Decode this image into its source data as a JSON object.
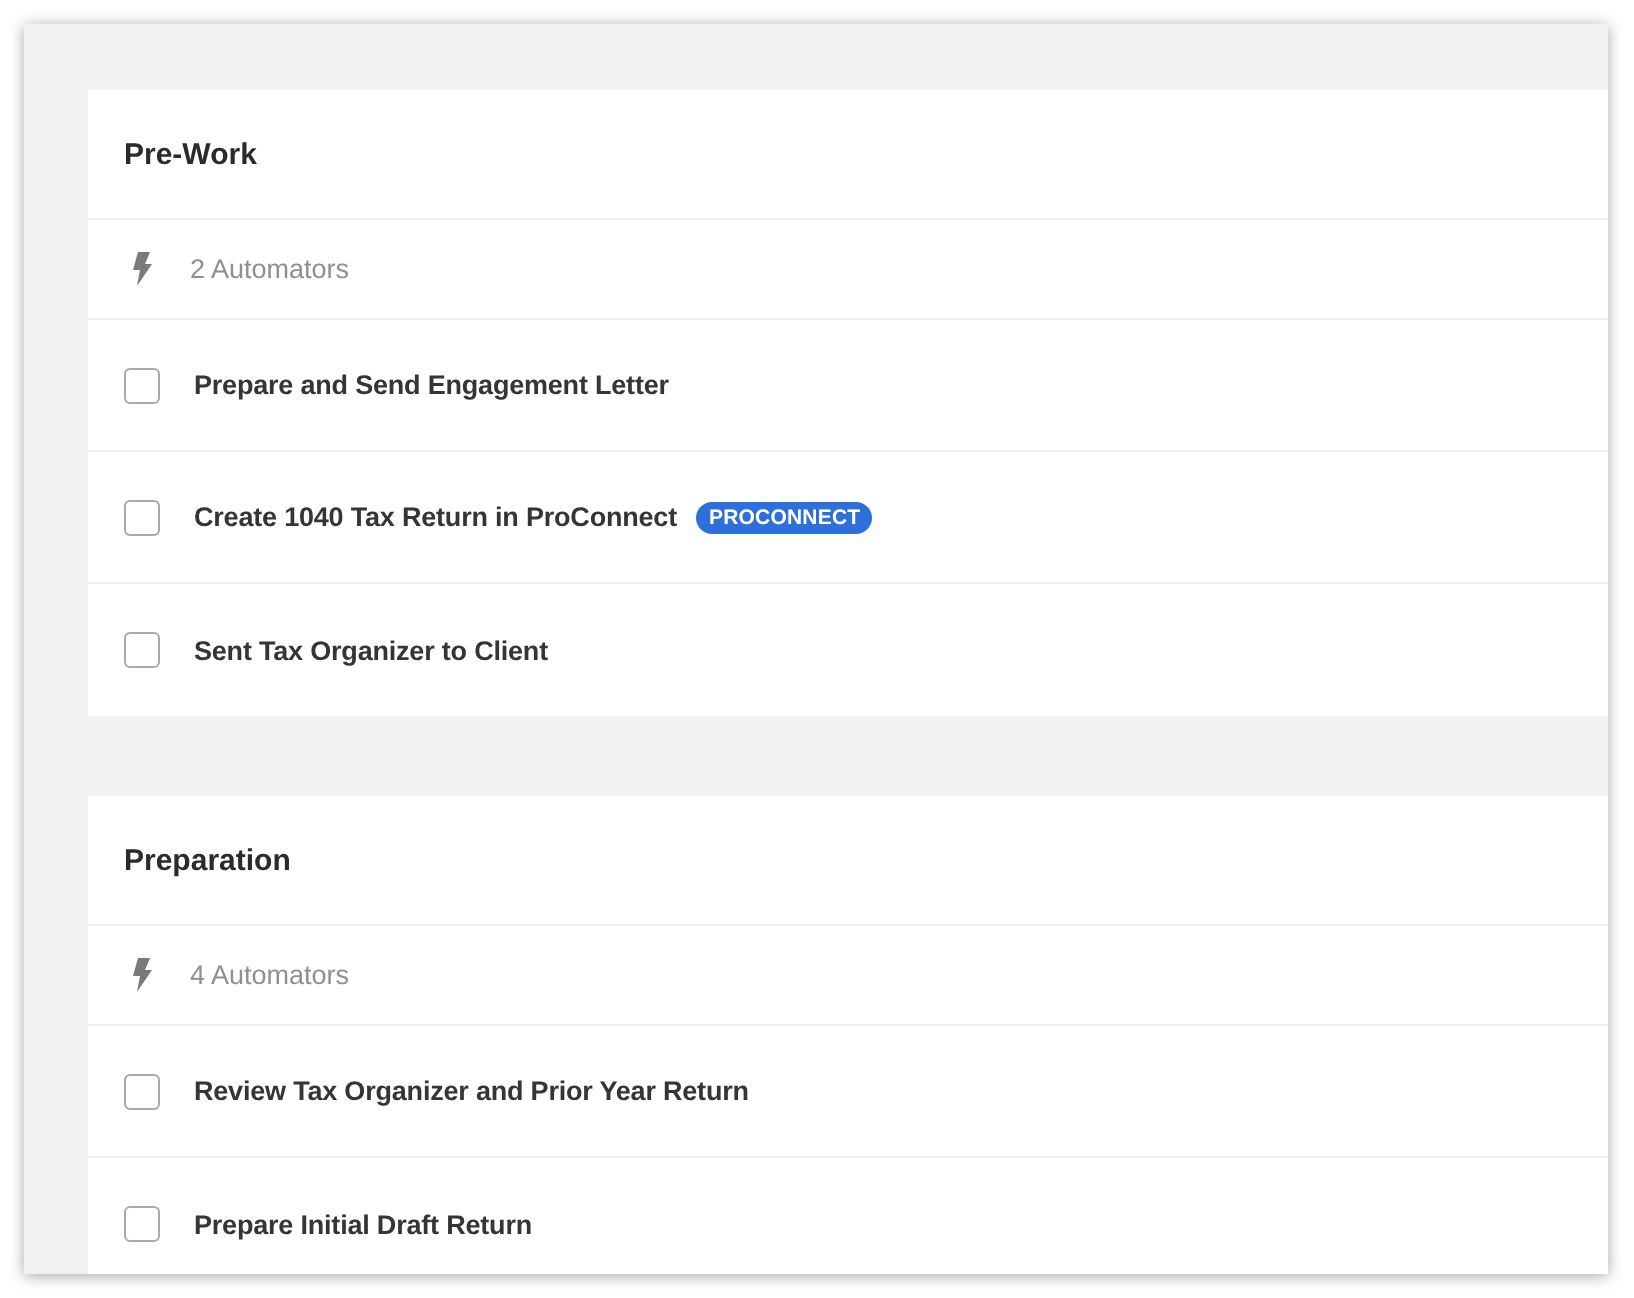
{
  "sections": [
    {
      "title": "Pre-Work",
      "automators": "2 Automators",
      "tasks": [
        {
          "label": "Prepare and Send Engagement Letter",
          "checked": false
        },
        {
          "label": "Create 1040 Tax Return in ProConnect",
          "checked": false,
          "badge": "PROCONNECT"
        },
        {
          "label": "Sent Tax Organizer to Client",
          "checked": false
        }
      ]
    },
    {
      "title": "Preparation",
      "automators": "4 Automators",
      "tasks": [
        {
          "label": "Review Tax Organizer and Prior Year Return",
          "checked": false
        },
        {
          "label": "Prepare Initial Draft Return",
          "checked": false
        }
      ]
    }
  ]
}
